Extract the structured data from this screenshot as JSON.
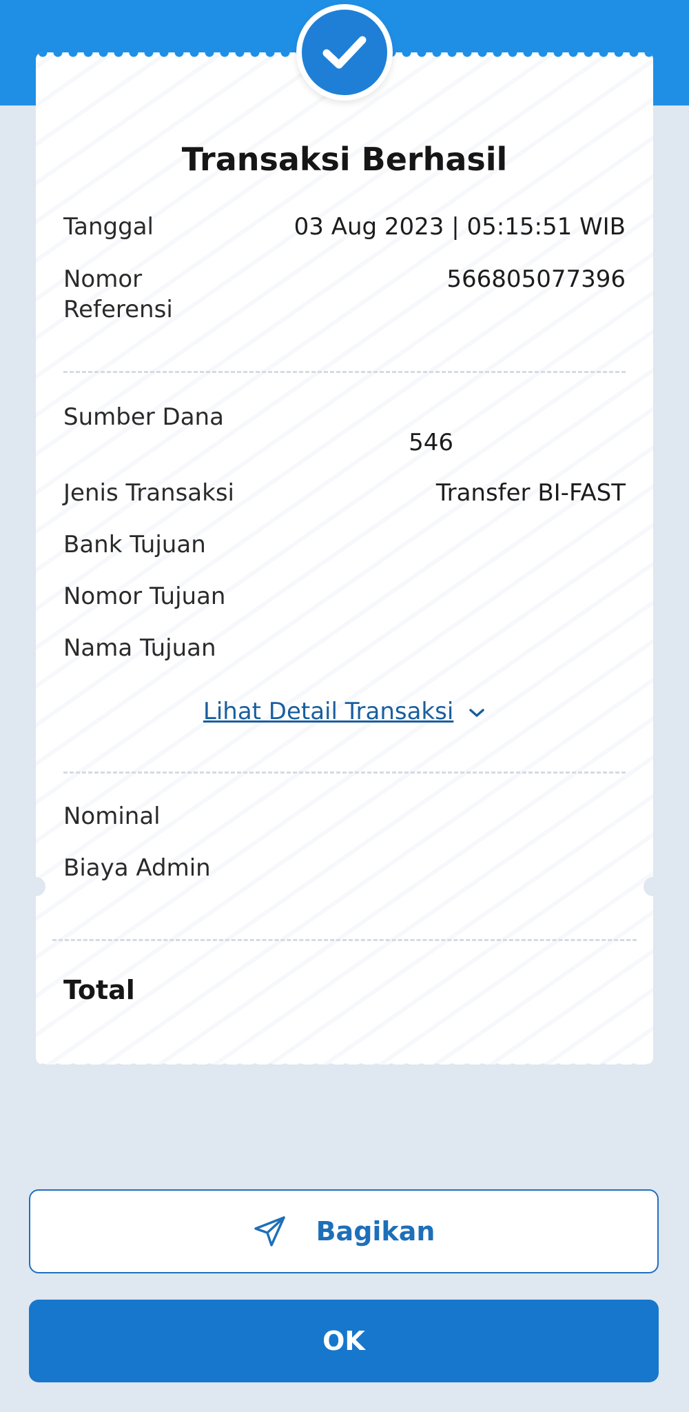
{
  "header": {
    "title": "Transaksi Berhasil",
    "status_icon": "check-icon",
    "accent_color": "#1f8fe6"
  },
  "rows_top": [
    {
      "label": "Tanggal",
      "value": "03 Aug 2023 | 05:15:51 WIB"
    },
    {
      "label": "Nomor\nReferensi",
      "value": "566805077396"
    }
  ],
  "rows_mid": [
    {
      "label": "Sumber Dana",
      "value": "546"
    },
    {
      "label": "Jenis Transaksi",
      "value": "Transfer BI-FAST"
    },
    {
      "label": "Bank Tujuan",
      "value": ""
    },
    {
      "label": "Nomor Tujuan",
      "value": ""
    },
    {
      "label": "Nama Tujuan",
      "value": ""
    }
  ],
  "detail_link": {
    "label": "Lihat Detail Transaksi",
    "icon": "chevron-down-icon"
  },
  "rows_amount": [
    {
      "label": "Nominal",
      "value": ""
    },
    {
      "label": "Biaya Admin",
      "value": ""
    }
  ],
  "total": {
    "label": "Total",
    "value": ""
  },
  "actions": {
    "share_label": "Bagikan",
    "share_icon": "send-icon",
    "ok_label": "OK"
  }
}
